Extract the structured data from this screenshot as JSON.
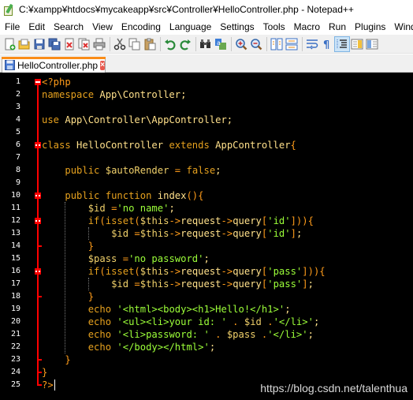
{
  "window": {
    "title": "C:¥xampp¥htdocs¥mycakeapp¥src¥Controller¥HelloController.php - Notepad++"
  },
  "menu": [
    "File",
    "Edit",
    "Search",
    "View",
    "Encoding",
    "Language",
    "Settings",
    "Tools",
    "Macro",
    "Run",
    "Plugins",
    "Window"
  ],
  "toolbar": {
    "buttons": [
      "new-file-icon",
      "open-file-icon",
      "save-icon",
      "save-all-icon",
      "close-icon",
      "close-all-icon",
      "print-icon",
      "cut-icon",
      "copy-icon",
      "paste-icon",
      "undo-icon",
      "redo-icon",
      "find-icon",
      "replace-icon",
      "zoom-in-icon",
      "zoom-out-icon",
      "sync-vertical-icon",
      "sync-horizontal-icon",
      "word-wrap-icon",
      "show-all-chars-icon",
      "indent-guide-icon",
      "doc-map-icon",
      "function-list-icon"
    ]
  },
  "tab": {
    "label": "HelloController.php",
    "close": "×"
  },
  "colors": {
    "editor_bg": "#000000",
    "tag": "#ff9c1a",
    "keyword": "#e6a11e",
    "default": "#ffe08a",
    "variable": "#f0d06a",
    "string": "#9cff39",
    "fold_marker": "#ff0000",
    "tab_accent": "#fa8c18"
  },
  "editor": {
    "lines": [
      [
        [
          "tag",
          "<?php"
        ]
      ],
      [
        [
          "kw",
          "namespace"
        ],
        [
          "def",
          " App\\Controller;"
        ]
      ],
      [],
      [
        [
          "kw",
          "use"
        ],
        [
          "def",
          " App\\Controller\\AppController;"
        ]
      ],
      [],
      [
        [
          "kw",
          "class"
        ],
        [
          "def",
          " HelloController "
        ],
        [
          "kw",
          "extends"
        ],
        [
          "def",
          " AppController"
        ],
        [
          "brk",
          "{"
        ]
      ],
      [],
      [
        [
          "def",
          "    "
        ],
        [
          "kw",
          "public"
        ],
        [
          "def",
          " "
        ],
        [
          "var",
          "$autoRender"
        ],
        [
          "def",
          " "
        ],
        [
          "op",
          "="
        ],
        [
          "def",
          " "
        ],
        [
          "kw",
          "false"
        ],
        [
          "def",
          ";"
        ]
      ],
      [],
      [
        [
          "def",
          "    "
        ],
        [
          "kw",
          "public"
        ],
        [
          "def",
          " "
        ],
        [
          "kw",
          "function"
        ],
        [
          "def",
          " index"
        ],
        [
          "brk",
          "(){"
        ]
      ],
      [
        [
          "def",
          "        "
        ],
        [
          "var",
          "$id"
        ],
        [
          "def",
          " "
        ],
        [
          "op",
          "="
        ],
        [
          "str",
          "'no name'"
        ],
        [
          "def",
          ";"
        ]
      ],
      [
        [
          "def",
          "        "
        ],
        [
          "kw",
          "if"
        ],
        [
          "brk",
          "("
        ],
        [
          "kw",
          "isset"
        ],
        [
          "brk",
          "("
        ],
        [
          "var",
          "$this"
        ],
        [
          "op",
          "->"
        ],
        [
          "def",
          "request"
        ],
        [
          "op",
          "->"
        ],
        [
          "def",
          "query"
        ],
        [
          "brk",
          "["
        ],
        [
          "str",
          "'id'"
        ],
        [
          "brk",
          "])){"
        ]
      ],
      [
        [
          "def",
          "            "
        ],
        [
          "var",
          "$id"
        ],
        [
          "def",
          " "
        ],
        [
          "op",
          "="
        ],
        [
          "var",
          "$this"
        ],
        [
          "op",
          "->"
        ],
        [
          "def",
          "request"
        ],
        [
          "op",
          "->"
        ],
        [
          "def",
          "query"
        ],
        [
          "brk",
          "["
        ],
        [
          "str",
          "'id'"
        ],
        [
          "brk",
          "]"
        ],
        [
          "def",
          ";"
        ]
      ],
      [
        [
          "def",
          "        "
        ],
        [
          "brk",
          "}"
        ]
      ],
      [
        [
          "def",
          "        "
        ],
        [
          "var",
          "$pass"
        ],
        [
          "def",
          " "
        ],
        [
          "op",
          "="
        ],
        [
          "str",
          "'no password'"
        ],
        [
          "def",
          ";"
        ]
      ],
      [
        [
          "def",
          "        "
        ],
        [
          "kw",
          "if"
        ],
        [
          "brk",
          "("
        ],
        [
          "kw",
          "isset"
        ],
        [
          "brk",
          "("
        ],
        [
          "var",
          "$this"
        ],
        [
          "op",
          "->"
        ],
        [
          "def",
          "request"
        ],
        [
          "op",
          "->"
        ],
        [
          "def",
          "query"
        ],
        [
          "brk",
          "["
        ],
        [
          "str",
          "'pass'"
        ],
        [
          "brk",
          "])){"
        ]
      ],
      [
        [
          "def",
          "            "
        ],
        [
          "var",
          "$id"
        ],
        [
          "def",
          " "
        ],
        [
          "op",
          "="
        ],
        [
          "var",
          "$this"
        ],
        [
          "op",
          "->"
        ],
        [
          "def",
          "request"
        ],
        [
          "op",
          "->"
        ],
        [
          "def",
          "query"
        ],
        [
          "brk",
          "["
        ],
        [
          "str",
          "'pass'"
        ],
        [
          "brk",
          "]"
        ],
        [
          "def",
          ";"
        ]
      ],
      [
        [
          "def",
          "        "
        ],
        [
          "brk",
          "}"
        ]
      ],
      [
        [
          "def",
          "        "
        ],
        [
          "kw",
          "echo"
        ],
        [
          "def",
          " "
        ],
        [
          "str",
          "'<html><body><h1>Hello!</h1>'"
        ],
        [
          "def",
          ";"
        ]
      ],
      [
        [
          "def",
          "        "
        ],
        [
          "kw",
          "echo"
        ],
        [
          "def",
          " "
        ],
        [
          "str",
          "'<ul><li>your id: '"
        ],
        [
          "def",
          " "
        ],
        [
          "op",
          "."
        ],
        [
          "def",
          " "
        ],
        [
          "var",
          "$id"
        ],
        [
          "def",
          " "
        ],
        [
          "op",
          "."
        ],
        [
          "str",
          "'</li>'"
        ],
        [
          "def",
          ";"
        ]
      ],
      [
        [
          "def",
          "        "
        ],
        [
          "kw",
          "echo"
        ],
        [
          "def",
          " "
        ],
        [
          "str",
          "'<li>password: '"
        ],
        [
          "def",
          " "
        ],
        [
          "op",
          "."
        ],
        [
          "def",
          " "
        ],
        [
          "var",
          "$pass"
        ],
        [
          "def",
          " "
        ],
        [
          "op",
          "."
        ],
        [
          "str",
          "'</li>'"
        ],
        [
          "def",
          ";"
        ]
      ],
      [
        [
          "def",
          "        "
        ],
        [
          "kw",
          "echo"
        ],
        [
          "def",
          " "
        ],
        [
          "str",
          "'</body></html>'"
        ],
        [
          "def",
          ";"
        ]
      ],
      [
        [
          "def",
          "    "
        ],
        [
          "brk",
          "}"
        ]
      ],
      [
        [
          "brk",
          "}"
        ]
      ],
      [
        [
          "tag",
          "?>"
        ]
      ]
    ]
  },
  "watermark": "https://blog.csdn.net/talenthua"
}
